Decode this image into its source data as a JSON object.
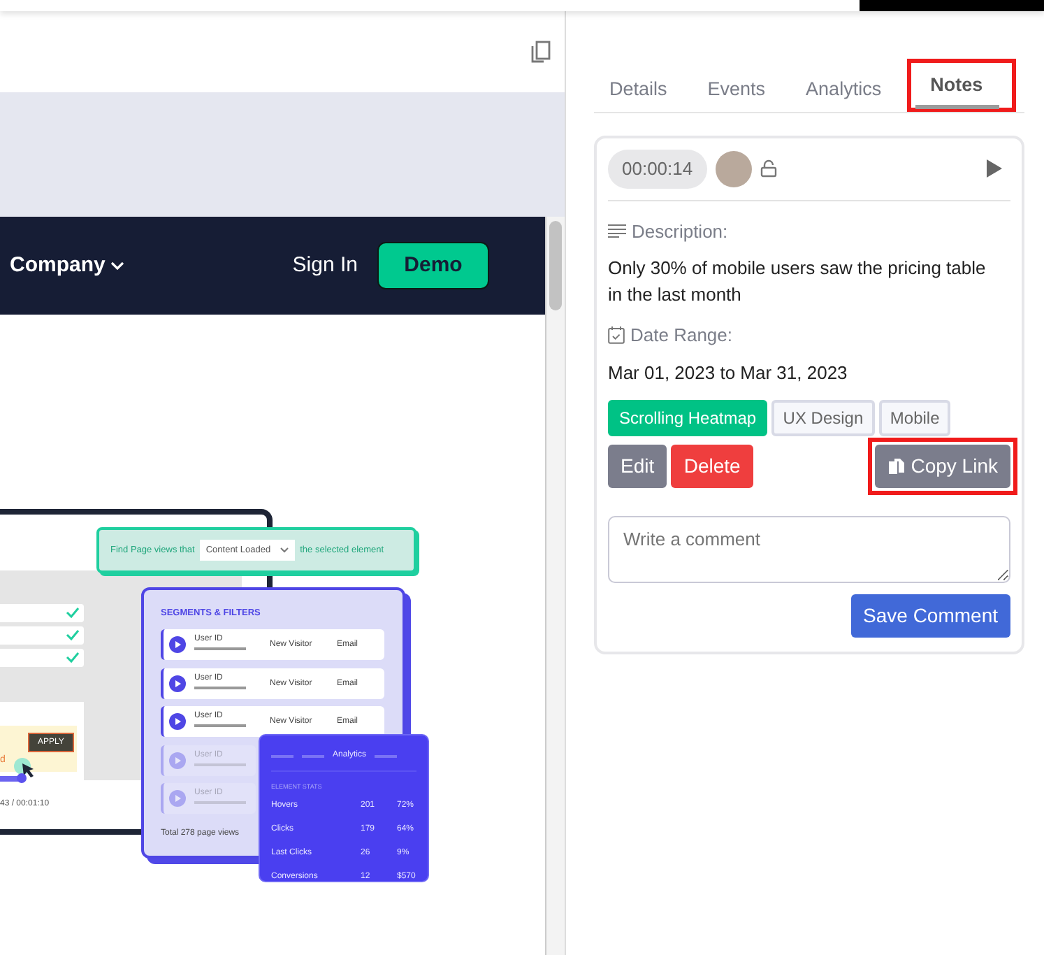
{
  "preview": {
    "navbar": {
      "menu_item": "Company",
      "sign_in": "Sign In",
      "demo": "Demo"
    },
    "illustration": {
      "filter_bar": {
        "prefix": "Find Page views that",
        "dropdown": "Content Loaded",
        "suffix": "the selected element"
      },
      "device": {
        "apply": "APPLY",
        "error_text": "d",
        "time": "43 / 00:01:10"
      },
      "segments": {
        "title": "SEGMENTS & FILTERS",
        "rows": [
          {
            "user": "User ID",
            "visitor": "New Visitor",
            "email": "Email",
            "faded": false
          },
          {
            "user": "User ID",
            "visitor": "New Visitor",
            "email": "Email",
            "faded": false
          },
          {
            "user": "User ID",
            "visitor": "New Visitor",
            "email": "Email",
            "faded": false
          },
          {
            "user": "User ID",
            "faded": true
          },
          {
            "user": "User ID",
            "faded": true
          }
        ],
        "total": "Total 278 page views"
      },
      "analytics": {
        "title": "Analytics",
        "subtitle": "ELEMENT STATS",
        "rows": [
          {
            "label": "Hovers",
            "count": "201",
            "share": "72%"
          },
          {
            "label": "Clicks",
            "count": "179",
            "share": "64%"
          },
          {
            "label": "Last Clicks",
            "count": "26",
            "share": "9%"
          },
          {
            "label": "Conversions",
            "count": "12",
            "share": "$570"
          }
        ]
      }
    }
  },
  "tabs": [
    {
      "label": "Details",
      "selected": false,
      "highlighted": false
    },
    {
      "label": "Events",
      "selected": false,
      "highlighted": false
    },
    {
      "label": "Analytics",
      "selected": false,
      "highlighted": false
    },
    {
      "label": "Notes",
      "selected": true,
      "highlighted": true
    }
  ],
  "note": {
    "time": "00:00:14",
    "description_label": "Description:",
    "description": "Only 30% of mobile users saw the pricing table in the last month",
    "date_label": "Date Range:",
    "date_range": "Mar 01, 2023 to Mar 31, 2023",
    "tags": [
      {
        "label": "Scrolling Heatmap",
        "kind": "primary"
      },
      {
        "label": "UX Design",
        "kind": "outline"
      },
      {
        "label": "Mobile",
        "kind": "outline"
      }
    ],
    "actions": [
      {
        "label": "Edit",
        "kind": "edit",
        "highlighted": false
      },
      {
        "label": "Delete",
        "kind": "delete",
        "highlighted": false
      },
      {
        "label": "Copy Link",
        "kind": "copy",
        "highlighted": true
      }
    ],
    "comment": {
      "placeholder": "Write a comment"
    },
    "save": "Save Comment"
  }
}
